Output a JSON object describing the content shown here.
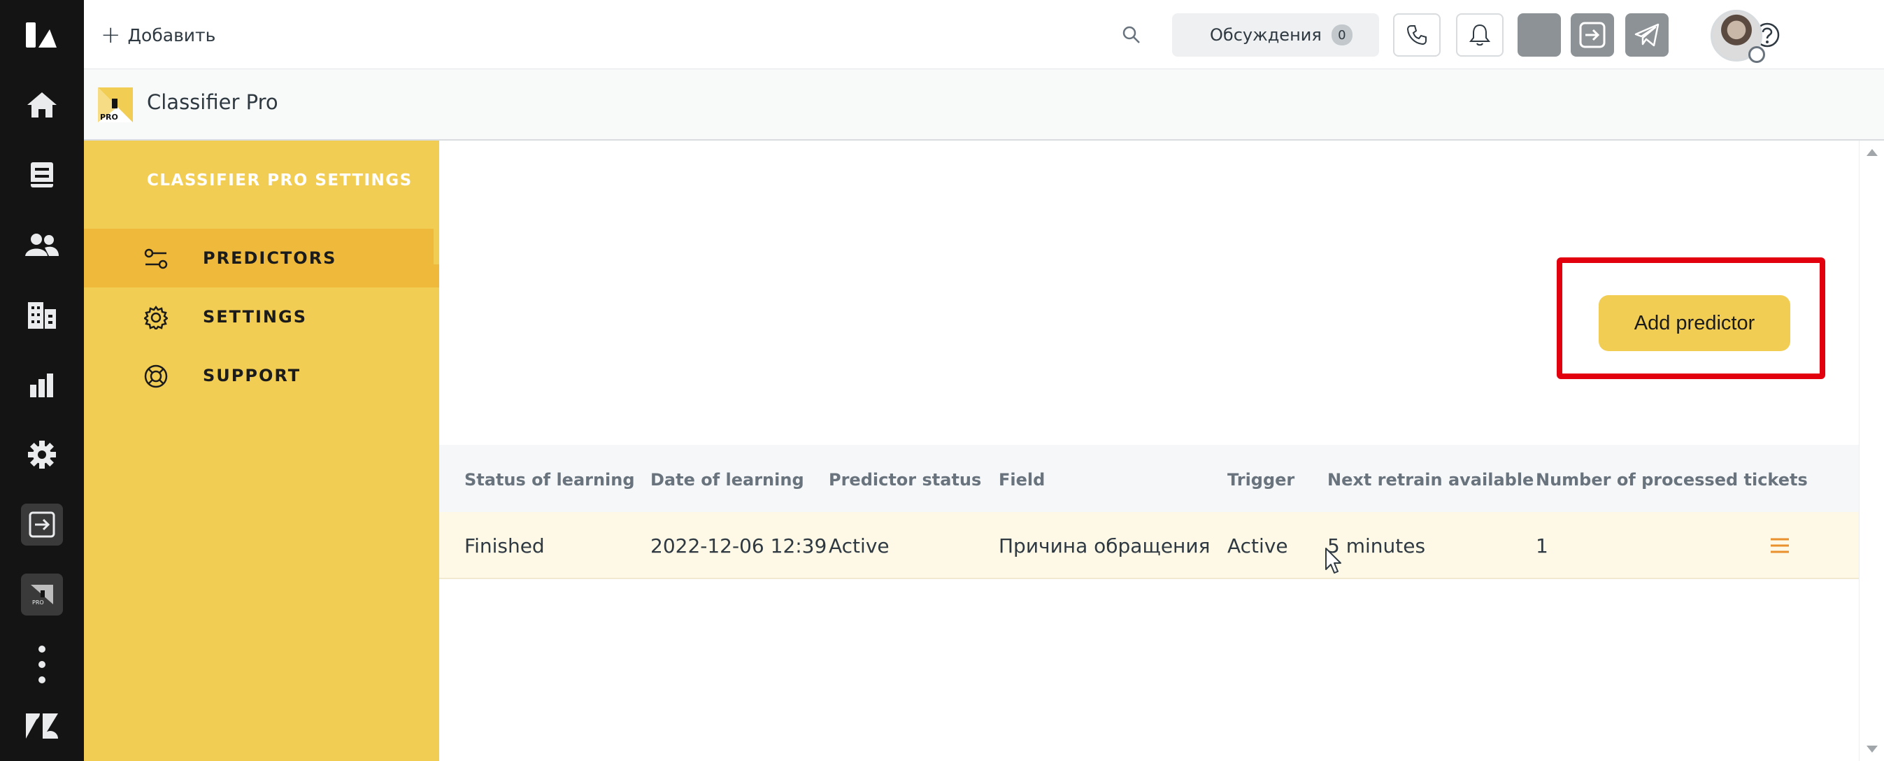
{
  "topbar": {
    "add_label": "Добавить",
    "discussions_label": "Обсуждения",
    "discussions_count": "0"
  },
  "app": {
    "title": "Classifier Pro",
    "logo_text": "PRO"
  },
  "sidebar": {
    "title": "CLASSIFIER PRO SETTINGS",
    "items": [
      {
        "label": "PREDICTORS",
        "icon": "predictors-icon",
        "active": true
      },
      {
        "label": "SETTINGS",
        "icon": "gear-icon",
        "active": false
      },
      {
        "label": "SUPPORT",
        "icon": "lifebuoy-icon",
        "active": false
      }
    ]
  },
  "main": {
    "add_predictor_label": "Add predictor",
    "table": {
      "columns": [
        "Status of learning",
        "Date of learning",
        "Predictor status",
        "Field",
        "Trigger",
        "Next retrain available",
        "Number of processed tickets"
      ],
      "rows": [
        [
          "Finished",
          "2022-12-06 12:39",
          "Active",
          "Причина обращения",
          "Active",
          "5 minutes",
          "1"
        ]
      ]
    }
  },
  "colors": {
    "rail": "#141414",
    "sidebar": "#f2cd54",
    "sidebar_active": "#efb93b",
    "button": "#f2cd54",
    "highlight": "#e2000f",
    "row_bg": "#fef9e7",
    "menu_icon": "#e8912d"
  }
}
